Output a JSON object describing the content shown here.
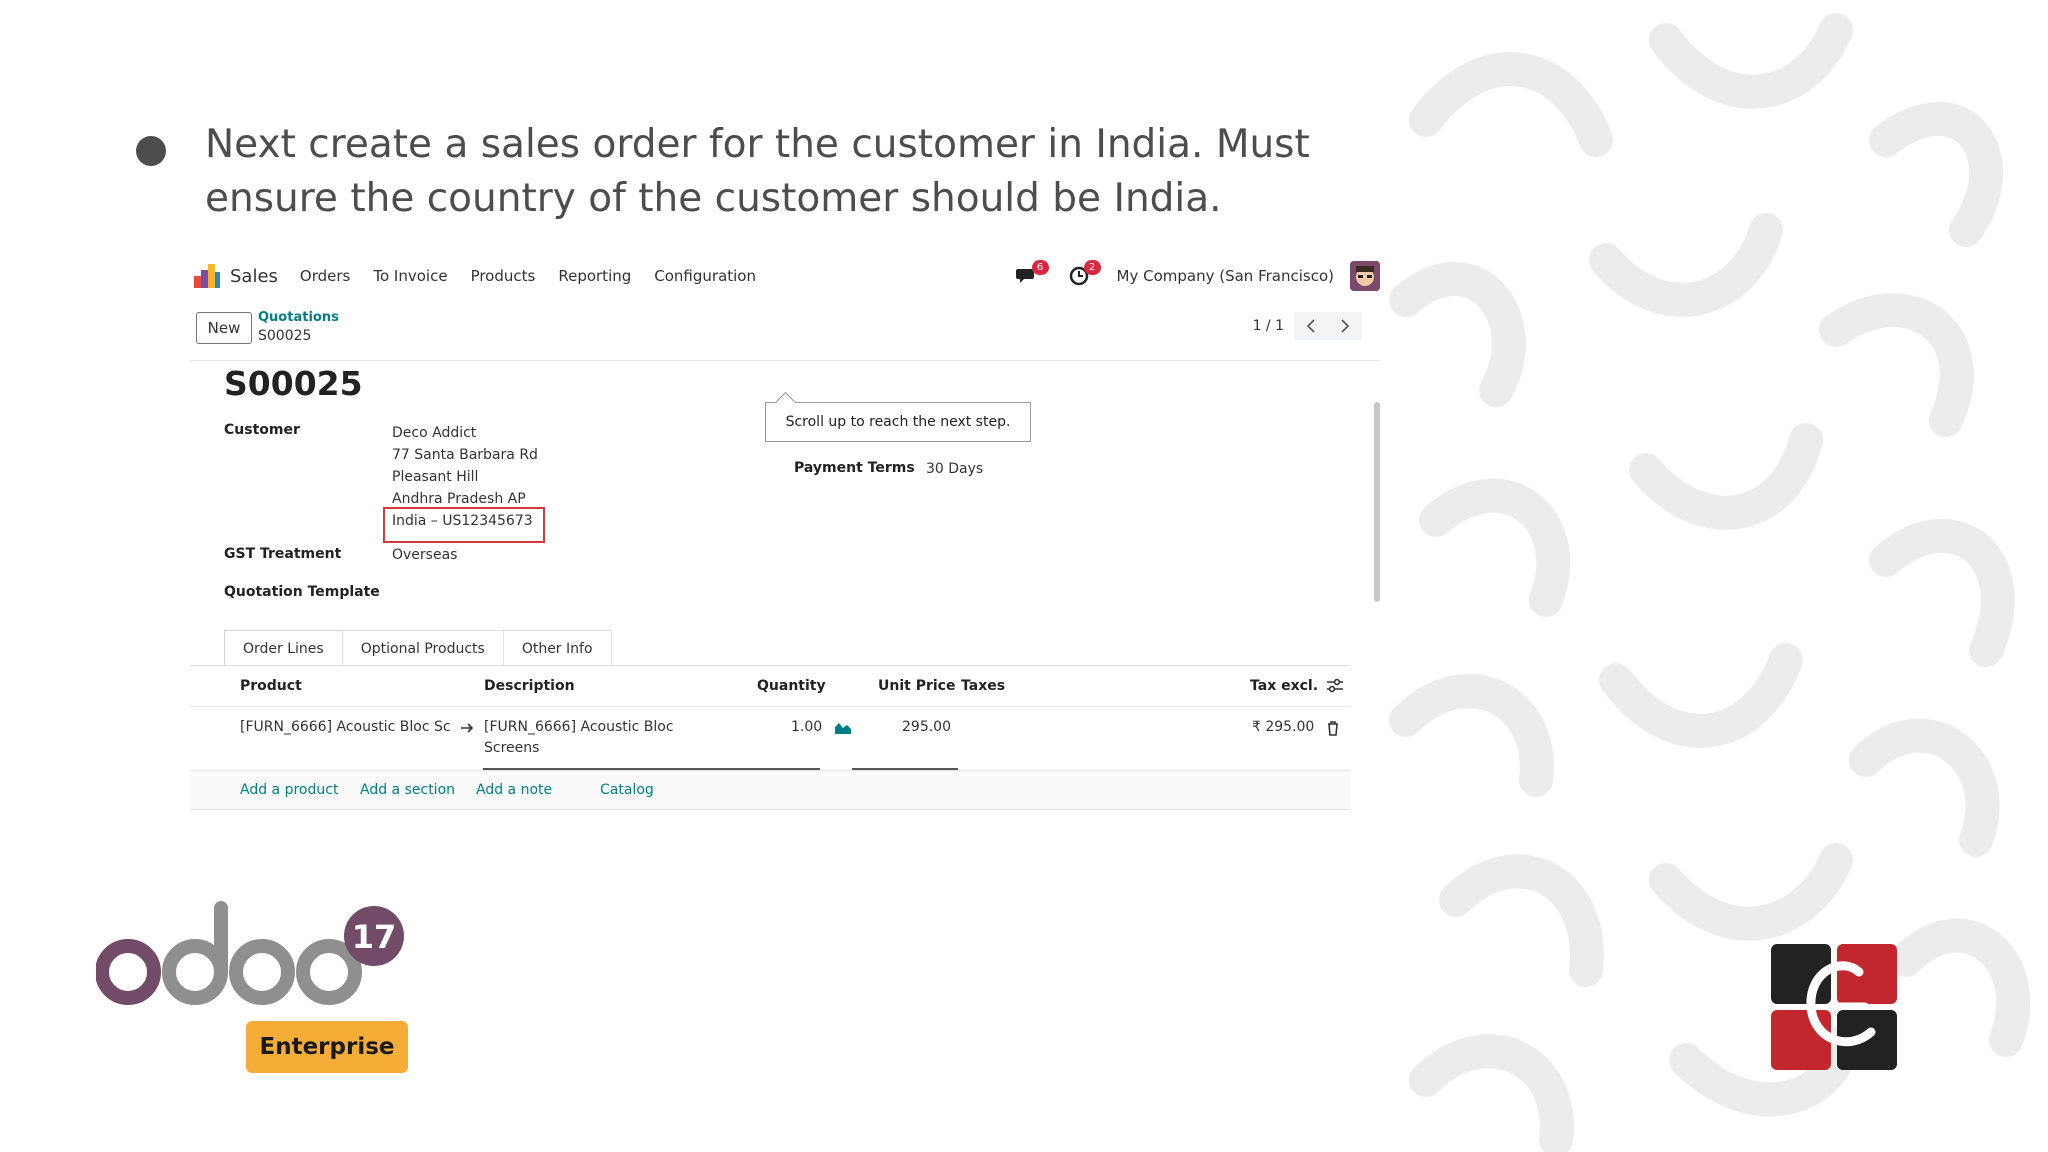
{
  "slide": {
    "text": "Next create a sales order for the customer in India. Must ensure the country of the customer should be India."
  },
  "navbar": {
    "app_name": "Sales",
    "menu": [
      "Orders",
      "To Invoice",
      "Products",
      "Reporting",
      "Configuration"
    ],
    "messages_badge": "6",
    "activities_badge": "2",
    "company": "My Company (San Francisco)"
  },
  "control": {
    "new_label": "New",
    "breadcrumb": "Quotations",
    "record": "S00025",
    "pager": "1 / 1"
  },
  "form": {
    "title": "S00025",
    "customer_label": "Customer",
    "customer_lines": [
      "Deco Addict",
      "77 Santa Barbara Rd",
      "Pleasant Hill",
      "Andhra Pradesh AP",
      "India – US12345673"
    ],
    "gst_label": "GST Treatment",
    "gst_value": "Overseas",
    "template_label": "Quotation Template",
    "tooltip": "Scroll up to reach the next step.",
    "payment_terms_label": "Payment Terms",
    "payment_terms_value": "30 Days"
  },
  "tabs": [
    "Order Lines",
    "Optional Products",
    "Other Info"
  ],
  "table": {
    "headers": {
      "product": "Product",
      "description": "Description",
      "quantity": "Quantity",
      "unit_price": "Unit Price",
      "taxes": "Taxes",
      "tax_excl": "Tax excl."
    },
    "row": {
      "product": "[FURN_6666] Acoustic Bloc Sc",
      "description_1": "[FURN_6666] Acoustic Bloc",
      "description_2": "Screens",
      "quantity": "1.00",
      "unit_price": "295.00",
      "subtotal": "₹ 295.00"
    },
    "actions": [
      "Add a product",
      "Add a section",
      "Add a note",
      "Catalog"
    ]
  },
  "branding": {
    "odoo_version": "17",
    "edition": "Enterprise",
    "colors": {
      "odoo_purple": "#714b67",
      "odoo_gray": "#8f8f8f",
      "enterprise_yellow": "#f6ad37",
      "corner_red": "#c1272d"
    }
  }
}
